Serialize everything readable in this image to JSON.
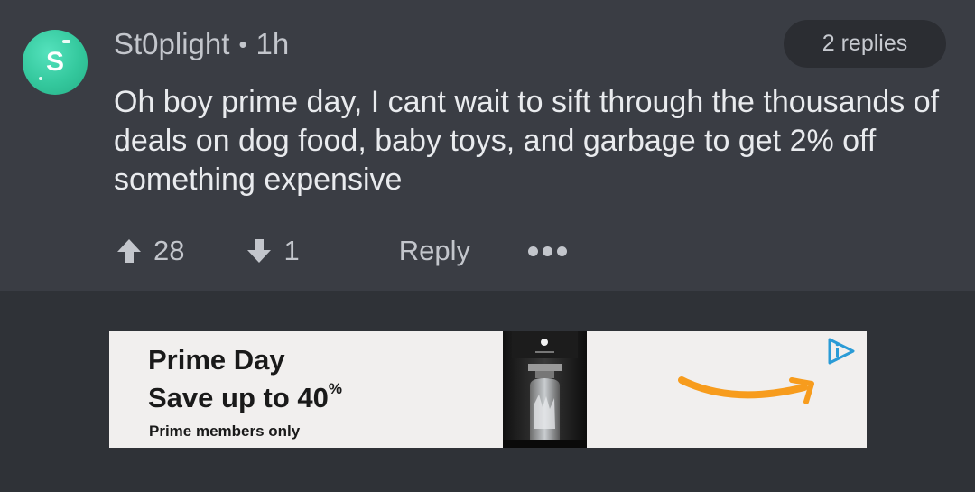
{
  "comment": {
    "avatar_letter": "S",
    "avatar_color": "#34c89d",
    "username": "St0plight",
    "separator": "•",
    "time": "1h",
    "replies_label": "2 replies",
    "body": "Oh boy prime day, I cant wait to sift through the thousands of deals on dog food, baby toys, and garbage to get 2% off something expensive",
    "upvotes": "28",
    "downvotes": "1",
    "reply_label": "Reply",
    "icons": [
      "upvote-arrow-icon",
      "downvote-arrow-icon",
      "more-options-icon"
    ]
  },
  "ad": {
    "title": "Prime Day",
    "subtitle": "Save up to 40",
    "subtitle_suffix": "%",
    "note": "Prime members only",
    "accent_color": "#f79c1d",
    "icons": [
      "amazon-smile-icon",
      "adchoices-icon"
    ]
  },
  "colors": {
    "page_bg": "#2f3237",
    "comment_bg": "#3a3d44",
    "ad_bg": "#f1efee"
  }
}
